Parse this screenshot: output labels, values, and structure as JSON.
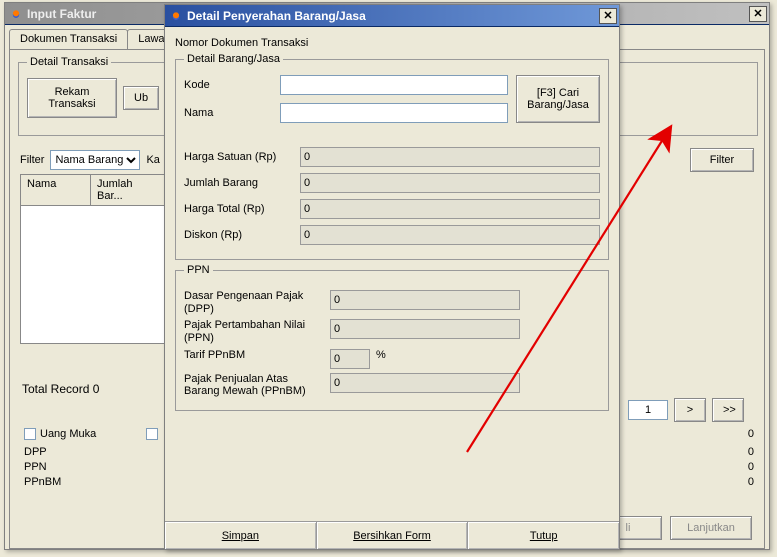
{
  "bg": {
    "title": "Input Faktur",
    "tabs": {
      "t1": "Dokumen Transaksi",
      "t2": "Lawan Tr"
    },
    "detail_group": "Detail Transaksi",
    "rekam_btn": "Rekam\nTransaksi",
    "ub_btn": "Ub",
    "filter_label": "Filter",
    "filter_dropdown": "Nama Barang",
    "ka_label": "Ka",
    "filter_btn": "Filter",
    "cols": {
      "nama": "Nama",
      "jumlah": "Jumlah Bar..."
    },
    "total_record_label": "Total Record",
    "total_record_val": "0",
    "uang_muka": "Uang Muka",
    "dpp": "DPP",
    "ppn": "PPN",
    "ppnbm": "PPnBM",
    "val0": "0",
    "page": "1",
    "nav_next": ">",
    "nav_last": ">>",
    "btn_li": "li",
    "btn_lanjutkan": "Lanjutkan"
  },
  "fg": {
    "title": "Detail Penyerahan Barang/Jasa",
    "sub_label": "Nomor Dokumen Transaksi",
    "group1": "Detail Barang/Jasa",
    "kode": "Kode",
    "nama": "Nama",
    "cari_btn_l1": "[F3] Cari",
    "cari_btn_l2": "Barang/Jasa",
    "harga_satuan": "Harga Satuan (Rp)",
    "jumlah_barang": "Jumlah Barang",
    "harga_total": "Harga Total (Rp)",
    "diskon": "Diskon (Rp)",
    "val0": "0",
    "group2": "PPN",
    "dpp": "Dasar Pengenaan Pajak (DPP)",
    "ppn": "Pajak Pertambahan Nilai (PPN)",
    "tarif": "Tarif PPnBM",
    "pct": "%",
    "ppnbm": "Pajak Penjualan Atas Barang Mewah (PPnBM)",
    "btn_simpan": "Simpan",
    "btn_bersih": "Bersihkan Form",
    "btn_tutup": "Tutup"
  }
}
